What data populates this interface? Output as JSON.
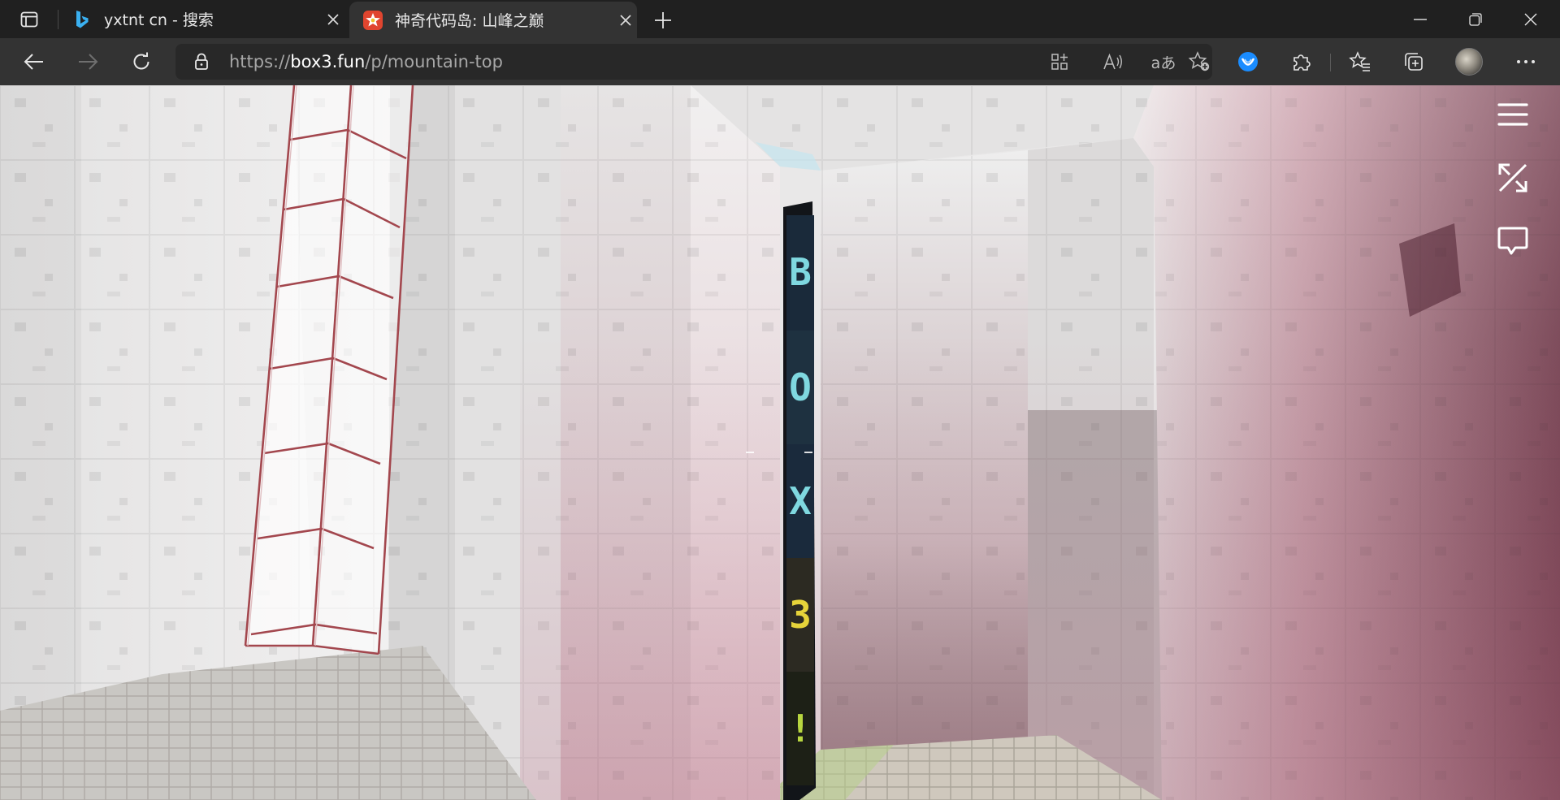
{
  "browser": {
    "tabs": [
      {
        "title": "yxtnt cn - 搜索",
        "favicon": "bing-logo-icon",
        "active": false
      },
      {
        "title": "神奇代码岛: 山峰之巅",
        "favicon": "box3-star-logo-icon",
        "active": true
      }
    ],
    "address": {
      "scheme": "https://",
      "host": "box3.fun",
      "path": "/p/mountain-top"
    },
    "accent_color": "#1a8cff"
  },
  "game": {
    "sign_letters": [
      "B",
      "O",
      "X",
      "3",
      "!"
    ],
    "sign_colors": [
      "#7fd8e0",
      "#7fd8e0",
      "#7fd8e0",
      "#e6d33a",
      "#b8d640"
    ],
    "hud": {
      "menu": "menu-icon",
      "fullscreen": "fullscreen-icon",
      "chat": "chat-icon"
    }
  }
}
